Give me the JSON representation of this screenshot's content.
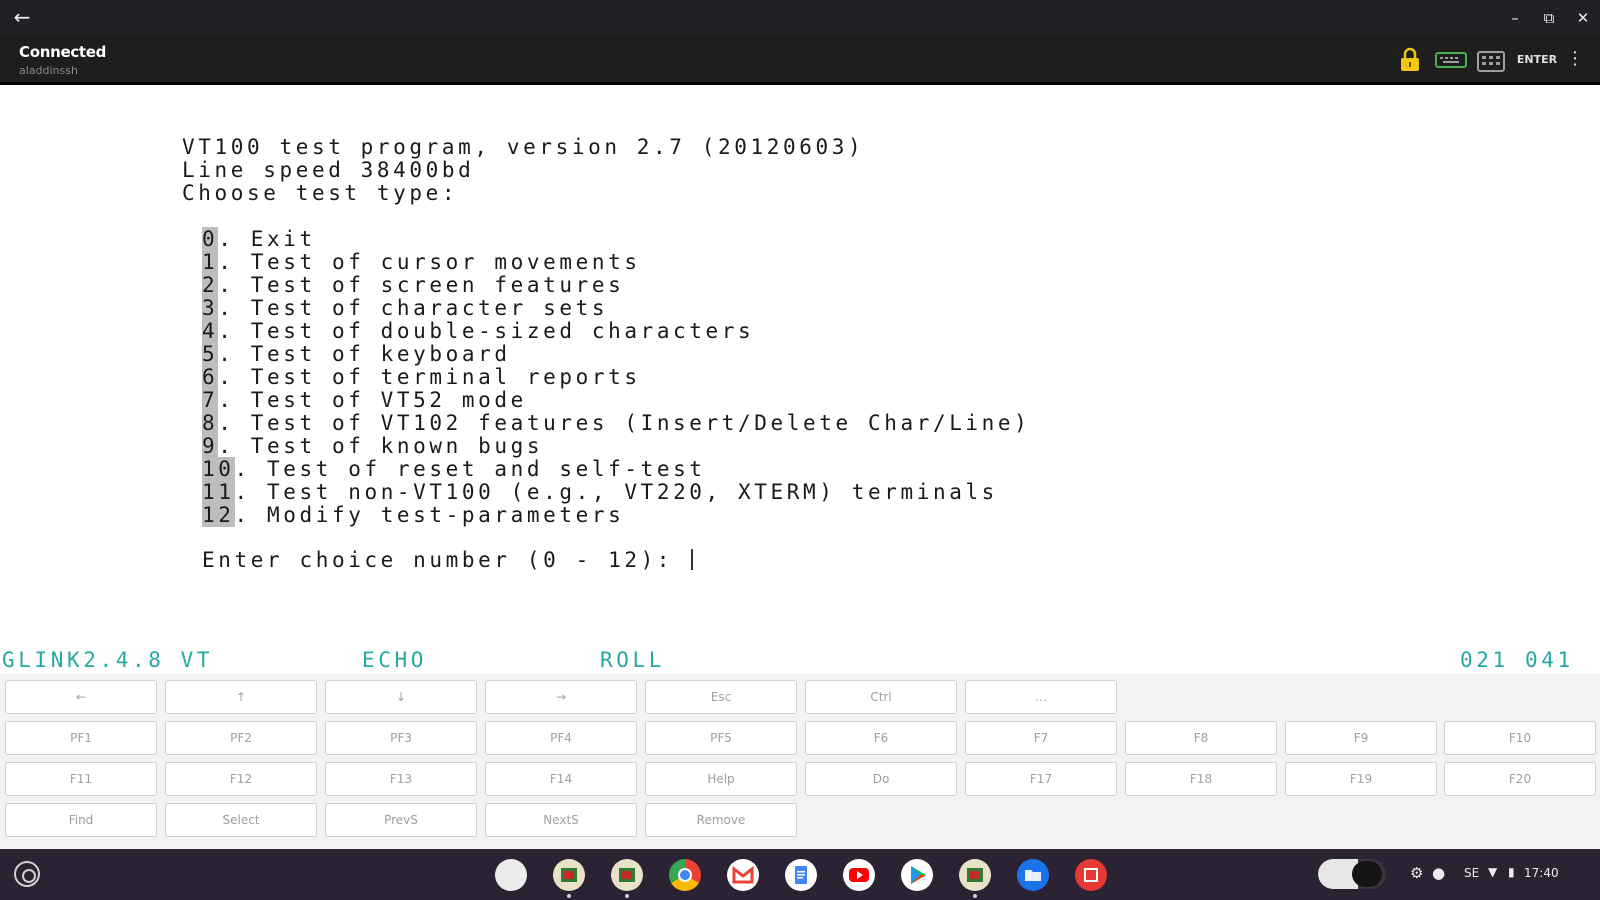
{
  "window": {
    "back_icon": "arrow-left-icon",
    "controls": [
      "minimize-icon",
      "restore-icon",
      "close-icon"
    ]
  },
  "appbar": {
    "status": "Connected",
    "host": "aladdinssh",
    "enter_label": "ENTER"
  },
  "terminal": {
    "header": [
      "VT100 test program, version 2.7 (20120603)",
      "Line speed 38400bd",
      "Choose test type:"
    ],
    "options": [
      {
        "num": "0",
        "text": ". Exit"
      },
      {
        "num": "1",
        "text": ". Test of cursor movements"
      },
      {
        "num": "2",
        "text": ". Test of screen features"
      },
      {
        "num": "3",
        "text": ". Test of character sets"
      },
      {
        "num": "4",
        "text": ". Test of double-sized characters"
      },
      {
        "num": "5",
        "text": ". Test of keyboard"
      },
      {
        "num": "6",
        "text": ". Test of terminal reports"
      },
      {
        "num": "7",
        "text": ". Test of VT52 mode"
      },
      {
        "num": "8",
        "text": ". Test of VT102 features (Insert/Delete Char/Line)"
      },
      {
        "num": "9",
        "text": ". Test of known bugs"
      },
      {
        "num": "10",
        "text": ". Test of reset and self-test"
      },
      {
        "num": "11",
        "text": ". Test non-VT100 (e.g., VT220, XTERM) terminals"
      },
      {
        "num": "12",
        "text": ". Modify test-parameters"
      }
    ],
    "prompt": "Enter choice number (0 - 12): "
  },
  "statusline": {
    "product": "GLINK2.4.8 VT",
    "echo": "ECHO",
    "roll": "ROLL",
    "position": "021 041"
  },
  "keypad": {
    "rows": [
      [
        "←",
        "↑",
        "↓",
        "→",
        "Esc",
        "Ctrl",
        "…"
      ],
      [
        "PF1",
        "PF2",
        "PF3",
        "PF4",
        "PF5",
        "F6",
        "F7",
        "F8",
        "F9",
        "F10"
      ],
      [
        "F11",
        "F12",
        "F13",
        "F14",
        "Help",
        "Do",
        "F17",
        "F18",
        "F19",
        "F20"
      ],
      [
        "Find",
        "Select",
        "PrevS",
        "NextS",
        "Remove"
      ]
    ]
  },
  "shelf": {
    "apps": [
      "gmail-like-icon",
      "glink-icon",
      "glink-icon",
      "chrome-icon",
      "gmail-icon",
      "docs-icon",
      "youtube-icon",
      "play-store-icon",
      "glink-icon",
      "files-icon",
      "app-red-icon"
    ],
    "colors": {
      "shelf_bg": "#2b2233",
      "status_color": "#26a9a3",
      "titlebar_bg": "#202124"
    },
    "tray": {
      "network": "SE",
      "time": "17:40"
    }
  }
}
